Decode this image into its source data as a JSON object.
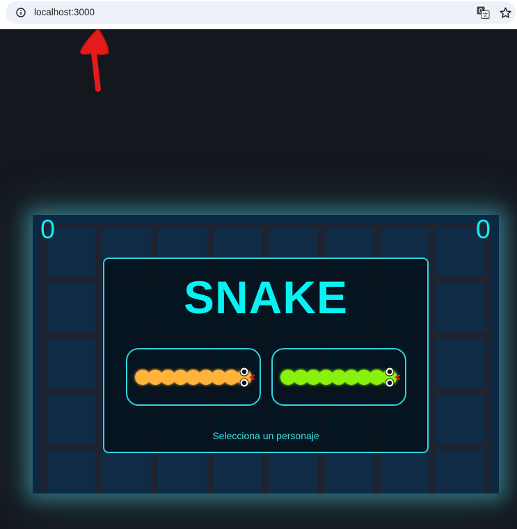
{
  "browser": {
    "url": "localhost:3000",
    "icons": [
      "info-icon",
      "translate-icon",
      "star-icon"
    ]
  },
  "game": {
    "title": "SNAKE",
    "score_left": "0",
    "score_right": "0",
    "prompt": "Selecciona un personaje",
    "characters": [
      {
        "name": "orange-snake",
        "color": "#ffb33a"
      },
      {
        "name": "green-snake",
        "color": "#88f20a"
      }
    ],
    "colors": {
      "accent": "#07f2f0",
      "board": "#0b2845",
      "annotation": "#e51b1b"
    }
  }
}
